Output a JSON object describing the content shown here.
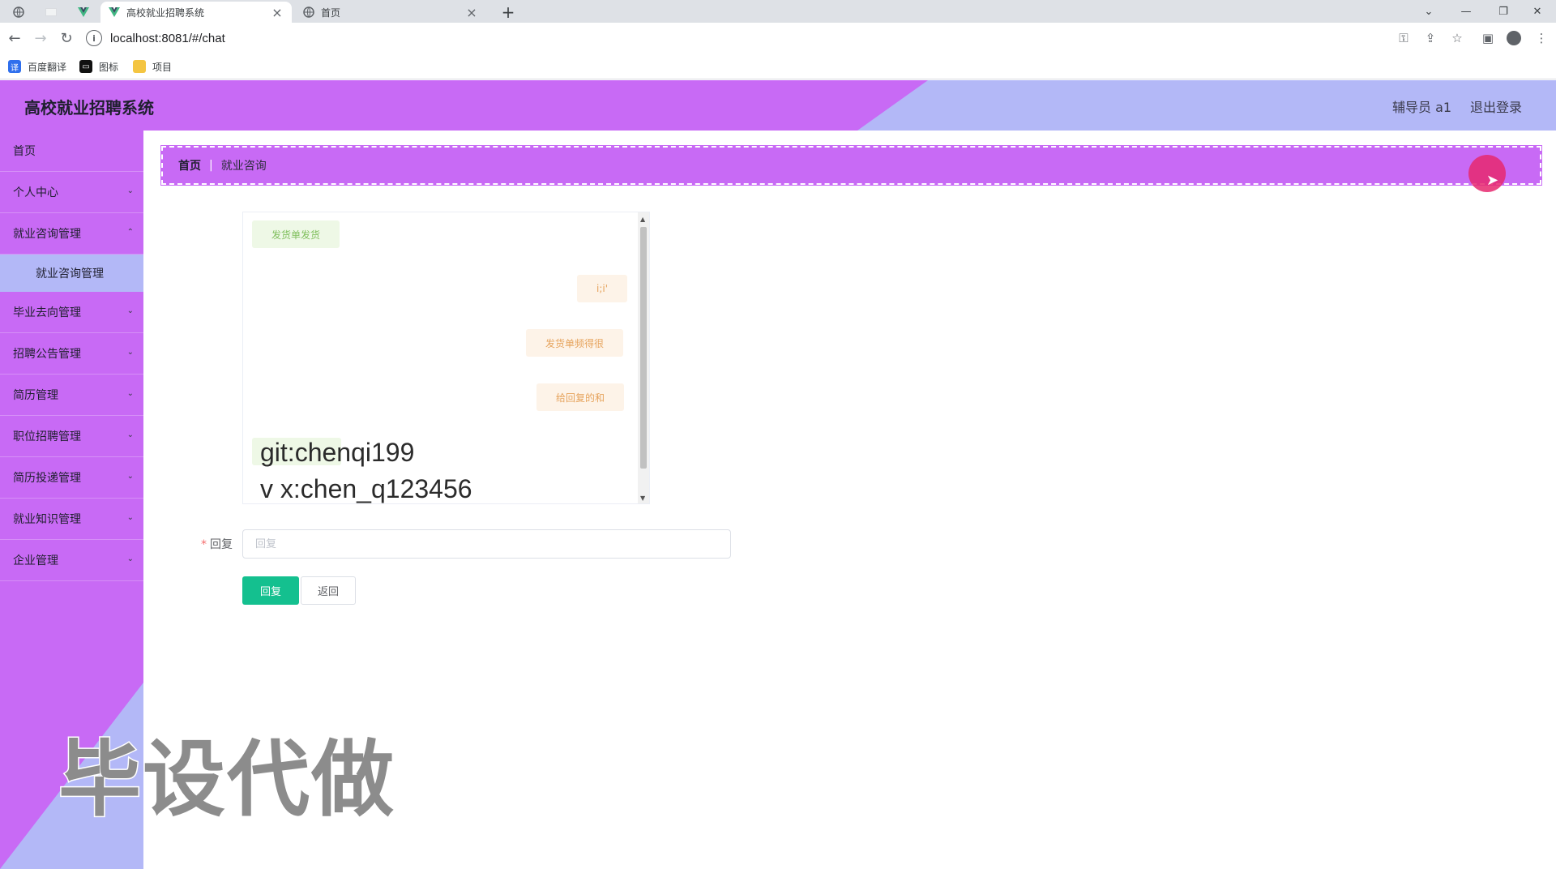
{
  "browser": {
    "tabs": [
      {
        "title": "高校就业招聘系统",
        "icon": "vue-icon",
        "active": true
      },
      {
        "title": "首页",
        "icon": "globe-icon",
        "active": false
      }
    ],
    "url": "localhost:8081/#/chat",
    "bookmarks": [
      {
        "label": "百度翻译",
        "icon": "translate-icon"
      },
      {
        "label": "图标",
        "icon": "image-icon"
      },
      {
        "label": "项目",
        "icon": "folder-icon"
      }
    ]
  },
  "header": {
    "title": "高校就业招聘系统",
    "user": "辅导员 a1",
    "logout": "退出登录",
    "colors": {
      "purple": "#c86af5",
      "lavender": "#b3b8f7"
    }
  },
  "sidebar": {
    "items": [
      {
        "label": "首页",
        "expandable": false
      },
      {
        "label": "个人中心",
        "expandable": true
      },
      {
        "label": "就业咨询管理",
        "expandable": true
      },
      {
        "label": "毕业去向管理",
        "expandable": true
      },
      {
        "label": "招聘公告管理",
        "expandable": true
      },
      {
        "label": "简历管理",
        "expandable": true
      },
      {
        "label": "职位招聘管理",
        "expandable": true
      },
      {
        "label": "简历投递管理",
        "expandable": true
      },
      {
        "label": "就业知识管理",
        "expandable": true
      },
      {
        "label": "企业管理",
        "expandable": true
      }
    ],
    "active_sub": "就业咨询管理"
  },
  "breadcrumb": {
    "home": "首页",
    "current": "就业咨询"
  },
  "chat": {
    "messages": [
      {
        "side": "left",
        "text": "发货单发货"
      },
      {
        "side": "right",
        "text": "i;i'"
      },
      {
        "side": "right",
        "text": "发货单频得很"
      },
      {
        "side": "right",
        "text": "给回复的和"
      }
    ]
  },
  "overlay": {
    "line1": "git:chenqi199",
    "line2": "v x:chen_q123456"
  },
  "form": {
    "reply_label": "回复",
    "required_mark": "*",
    "reply_placeholder": "回复",
    "reply_value": "",
    "submit_label": "回复",
    "back_label": "返回",
    "accent": "#14c08f"
  },
  "watermark": "毕设代做"
}
